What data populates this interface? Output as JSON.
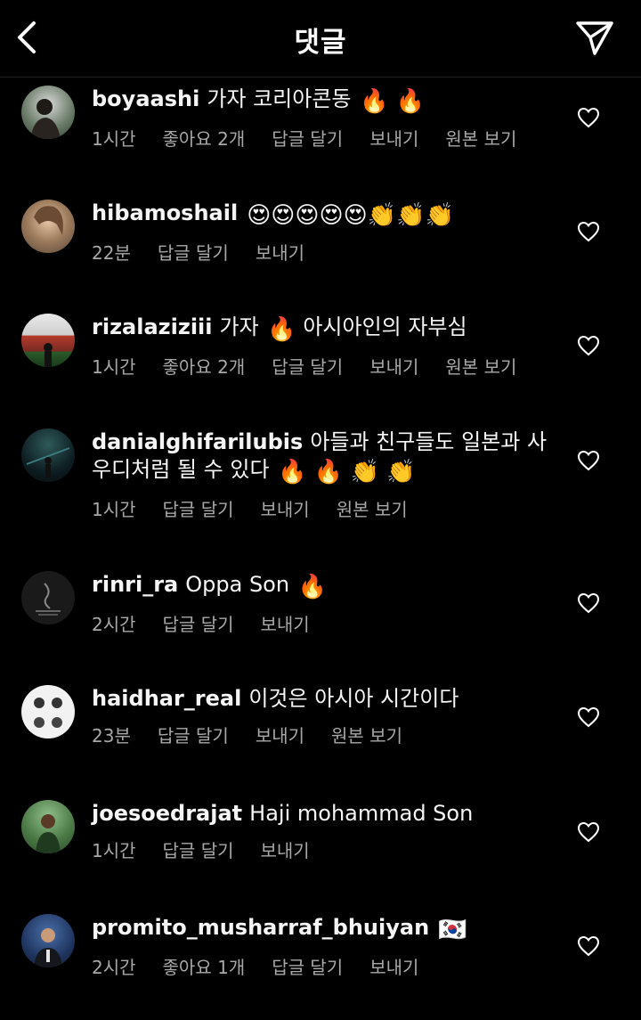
{
  "header": {
    "title": "댓글",
    "back_icon": "chevron-left-icon",
    "send_icon": "paper-plane-icon"
  },
  "labels": {
    "reply": "답글 달기",
    "send": "보내기",
    "see_original": "원본 보기"
  },
  "comments": [
    {
      "username": "boyaashi",
      "text": "가자 코리아콘동",
      "emoji": "🔥 🔥",
      "time": "1시간",
      "likes": "좋아요 2개",
      "see_original": true
    },
    {
      "username": "hibamoshail",
      "text": "",
      "emoji": "😍😍😍😍😍👏👏👏",
      "time": "22분",
      "likes": "",
      "see_original": false
    },
    {
      "username": "rizalaziziii",
      "text": "가자",
      "emoji": "🔥",
      "text2": "아시아인의 자부심",
      "time": "1시간",
      "likes": "좋아요 2개",
      "see_original": true
    },
    {
      "username": "danialghifarilubis",
      "text": "아들과 친구들도 일본과 사우디처럼 될 수 있다",
      "emoji": "🔥 🔥 👏 👏",
      "time": "1시간",
      "likes": "",
      "see_original": true
    },
    {
      "username": "rinri_ra",
      "text": "Oppa Son",
      "emoji": "🔥",
      "time": "2시간",
      "likes": "",
      "see_original": false
    },
    {
      "username": "haidhar_real",
      "text": "이것은 아시아 시간이다",
      "emoji": "",
      "time": "23분",
      "likes": "",
      "see_original": true
    },
    {
      "username": "joesoedrajat",
      "text": "Haji mohammad Son",
      "emoji": "",
      "time": "1시간",
      "likes": "",
      "see_original": false
    },
    {
      "username": "promito_musharraf_bhuiyan",
      "text": "",
      "emoji": "🇰🇷",
      "time": "2시간",
      "likes": "좋아요 1개",
      "see_original": false
    }
  ]
}
